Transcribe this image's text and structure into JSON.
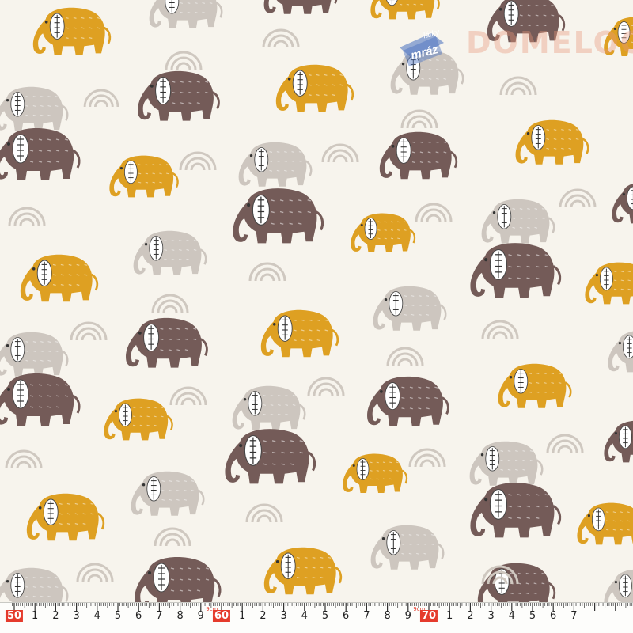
{
  "image": {
    "subject": "Cream fabric printed with repeating elephants and rainbow arcs, with a measuring tape along the bottom edge",
    "colors": {
      "background": "#f7f4ed",
      "ochre_elephant": "#dea022",
      "brown_elephant": "#745b58",
      "grey_elephant": "#cdc6bf",
      "arc": "#cfc8c0",
      "ruler_red": "#e53b2c"
    }
  },
  "watermark": {
    "badge_line1": "látky",
    "badge_line2": "mráz",
    "brand": "DOMELOOK.SK"
  },
  "ruler": {
    "labels": [
      "50",
      "1",
      "2",
      "3",
      "4",
      "5",
      "6",
      "7",
      "8",
      "9",
      "60",
      "1",
      "2",
      "3",
      "4",
      "5",
      "6",
      "7",
      "8",
      "9",
      "70",
      "1",
      "2",
      "3",
      "4",
      "5",
      "6",
      "7"
    ],
    "unit_marks": [
      "9cm",
      "9cm"
    ]
  }
}
